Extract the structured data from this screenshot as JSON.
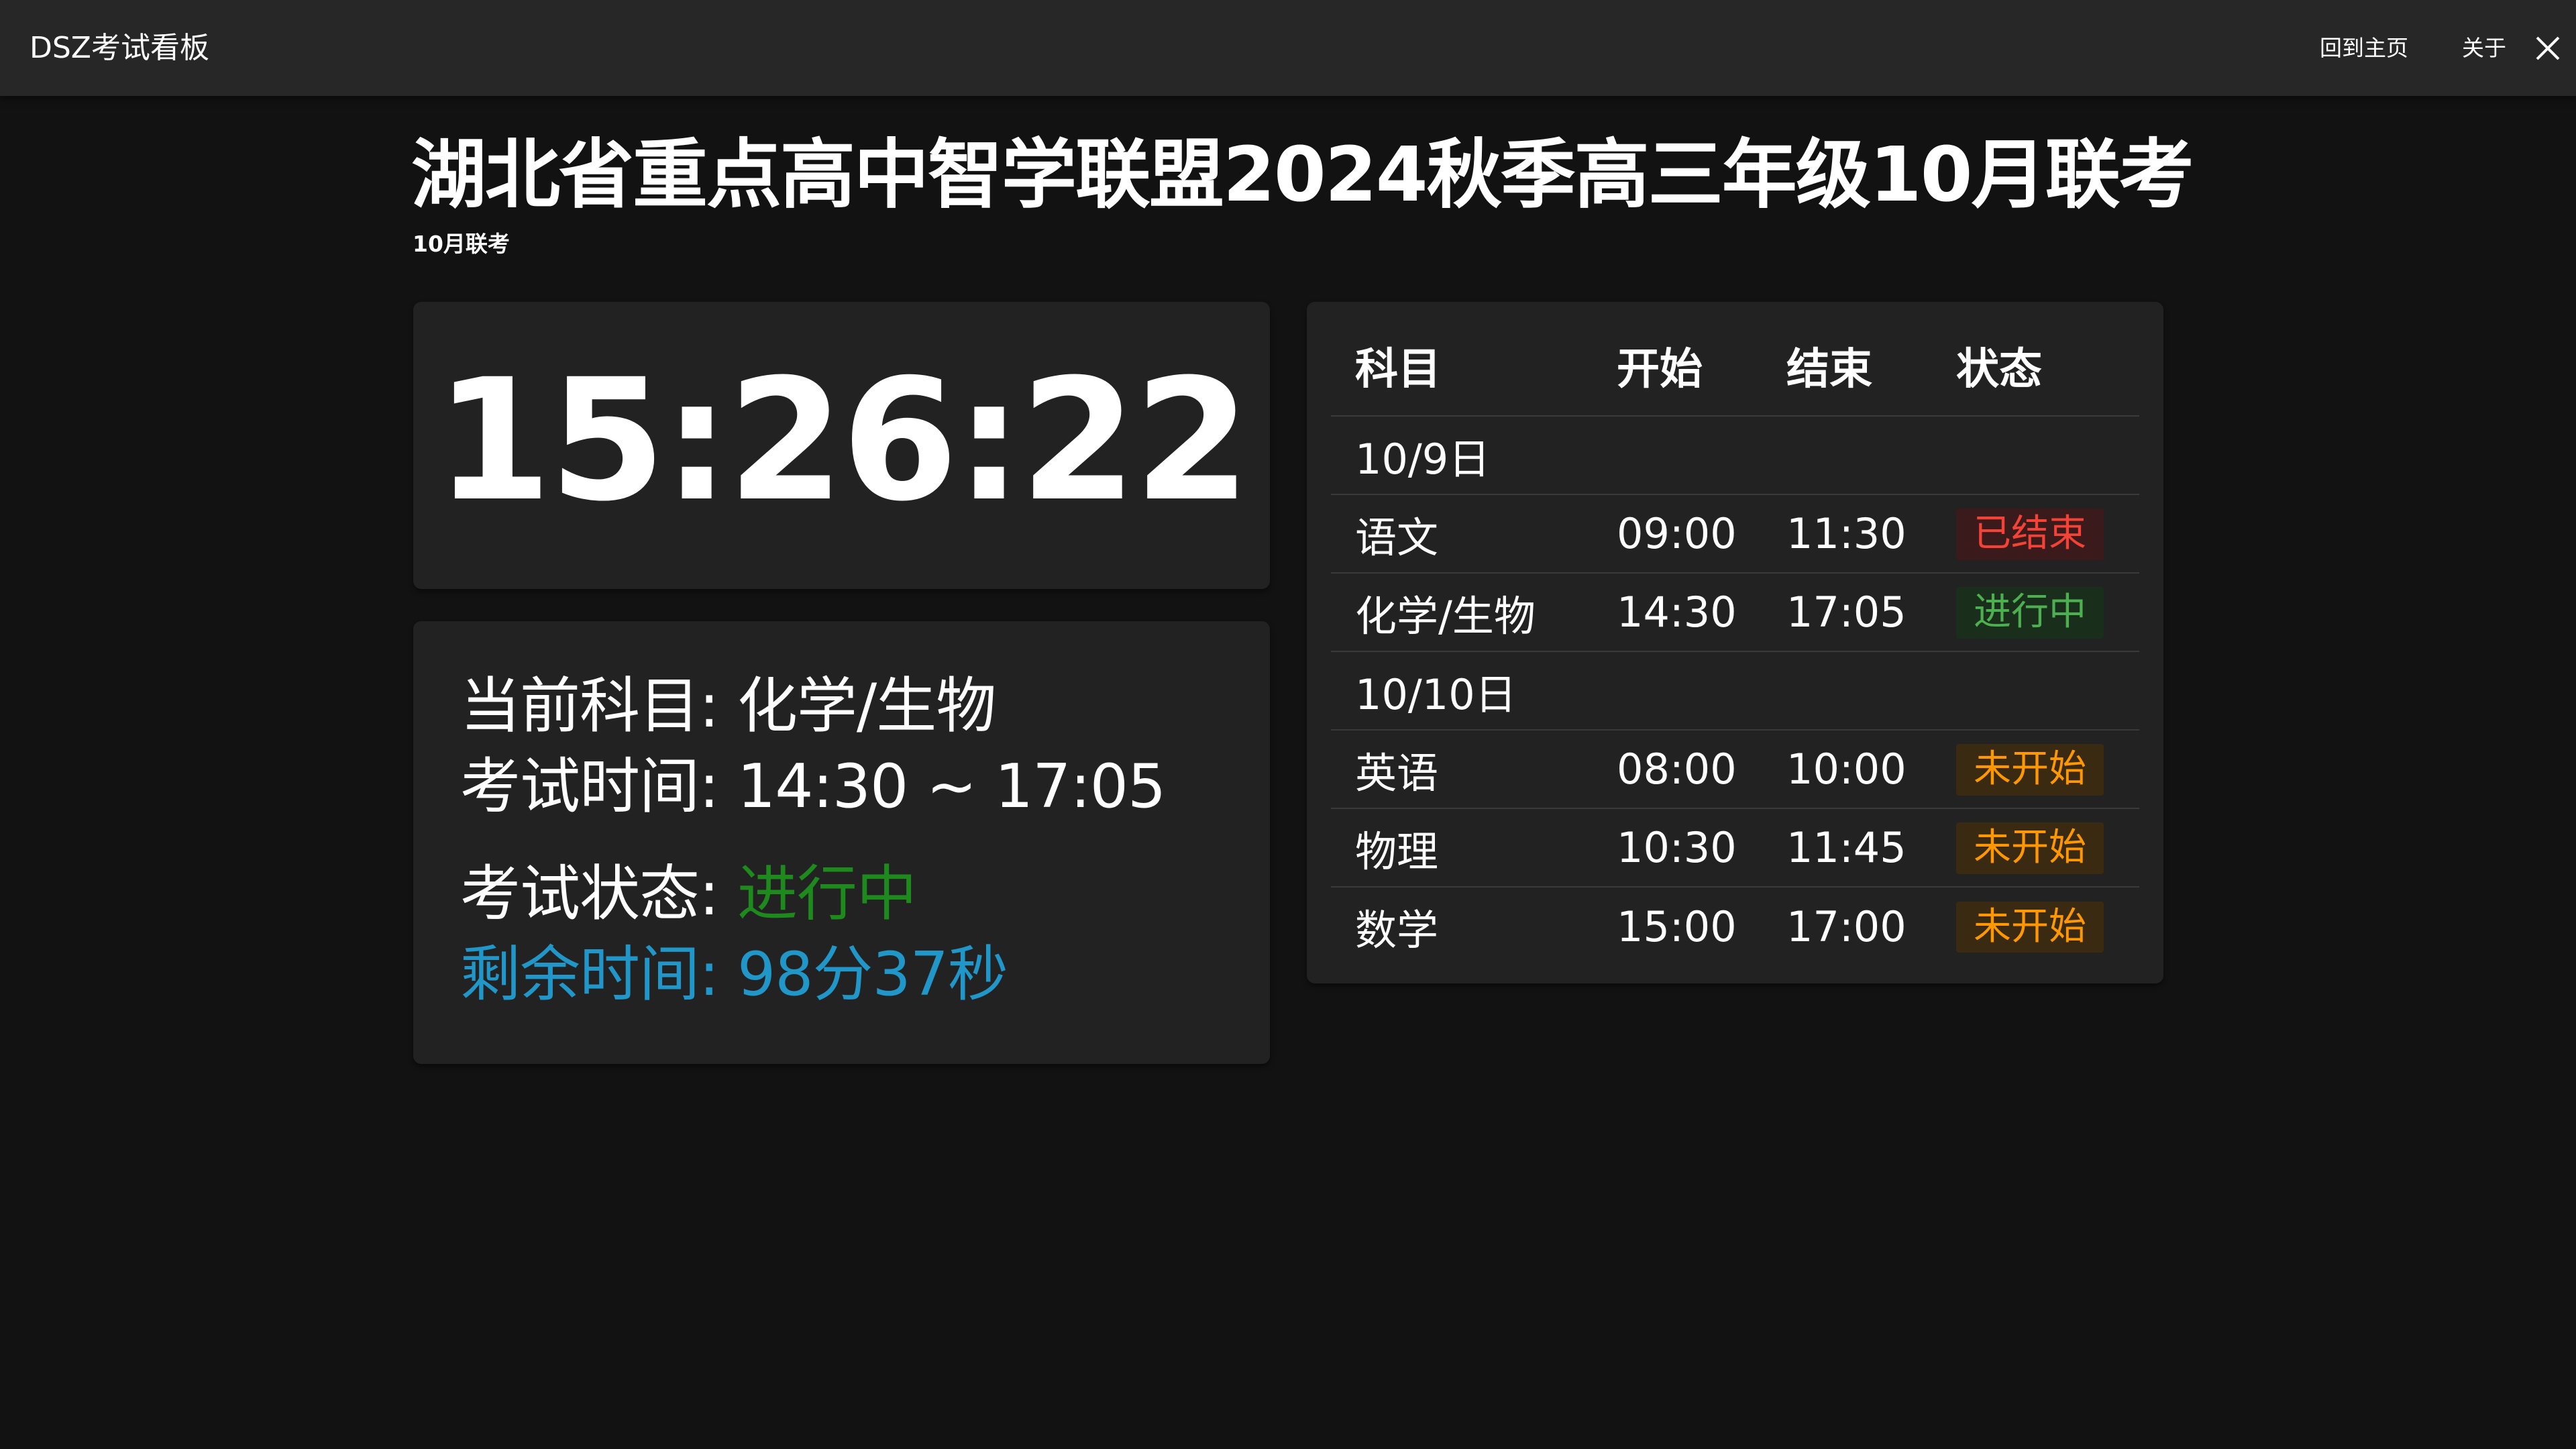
{
  "appbar": {
    "title": "DSZ考试看板",
    "home_label": "回到主页",
    "about_label": "关于",
    "close_icon": "close-icon"
  },
  "header": {
    "title": "湖北省重点高中智学联盟2024秋季高三年级10月联考",
    "subtitle": "10月联考"
  },
  "clock": {
    "time": "15:26:22"
  },
  "current": {
    "subject_label": "当前科目: ",
    "subject_value": "化学/生物",
    "time_label": "考试时间: ",
    "time_value": "14:30 ~ 17:05",
    "status_label": "考试状态: ",
    "status_value": "进行中",
    "status_color": "#1e8a1e",
    "remaining_label": "剩余时间: ",
    "remaining_value": "98分37秒",
    "remaining_color": "#2196c8"
  },
  "schedule": {
    "headers": {
      "subject": "科目",
      "start": "开始",
      "end": "结束",
      "status": "状态"
    },
    "day1": {
      "date": "10/9日",
      "rows": [
        {
          "subject": "语文",
          "start": "09:00",
          "end": "11:30",
          "status": "已结束",
          "status_type": "ended"
        },
        {
          "subject": "化学/生物",
          "start": "14:30",
          "end": "17:05",
          "status": "进行中",
          "status_type": "active"
        }
      ]
    },
    "day2": {
      "date": "10/10日",
      "rows": [
        {
          "subject": "英语",
          "start": "08:00",
          "end": "10:00",
          "status": "未开始",
          "status_type": "pending"
        },
        {
          "subject": "物理",
          "start": "10:30",
          "end": "11:45",
          "status": "未开始",
          "status_type": "pending"
        },
        {
          "subject": "数学",
          "start": "15:00",
          "end": "17:00",
          "status": "未开始",
          "status_type": "pending"
        }
      ]
    }
  },
  "colors": {
    "background": "#121212",
    "appbar": "#272727",
    "card": "#222222",
    "ended": "#f44336",
    "active": "#4caf50",
    "pending": "#ff9800"
  }
}
